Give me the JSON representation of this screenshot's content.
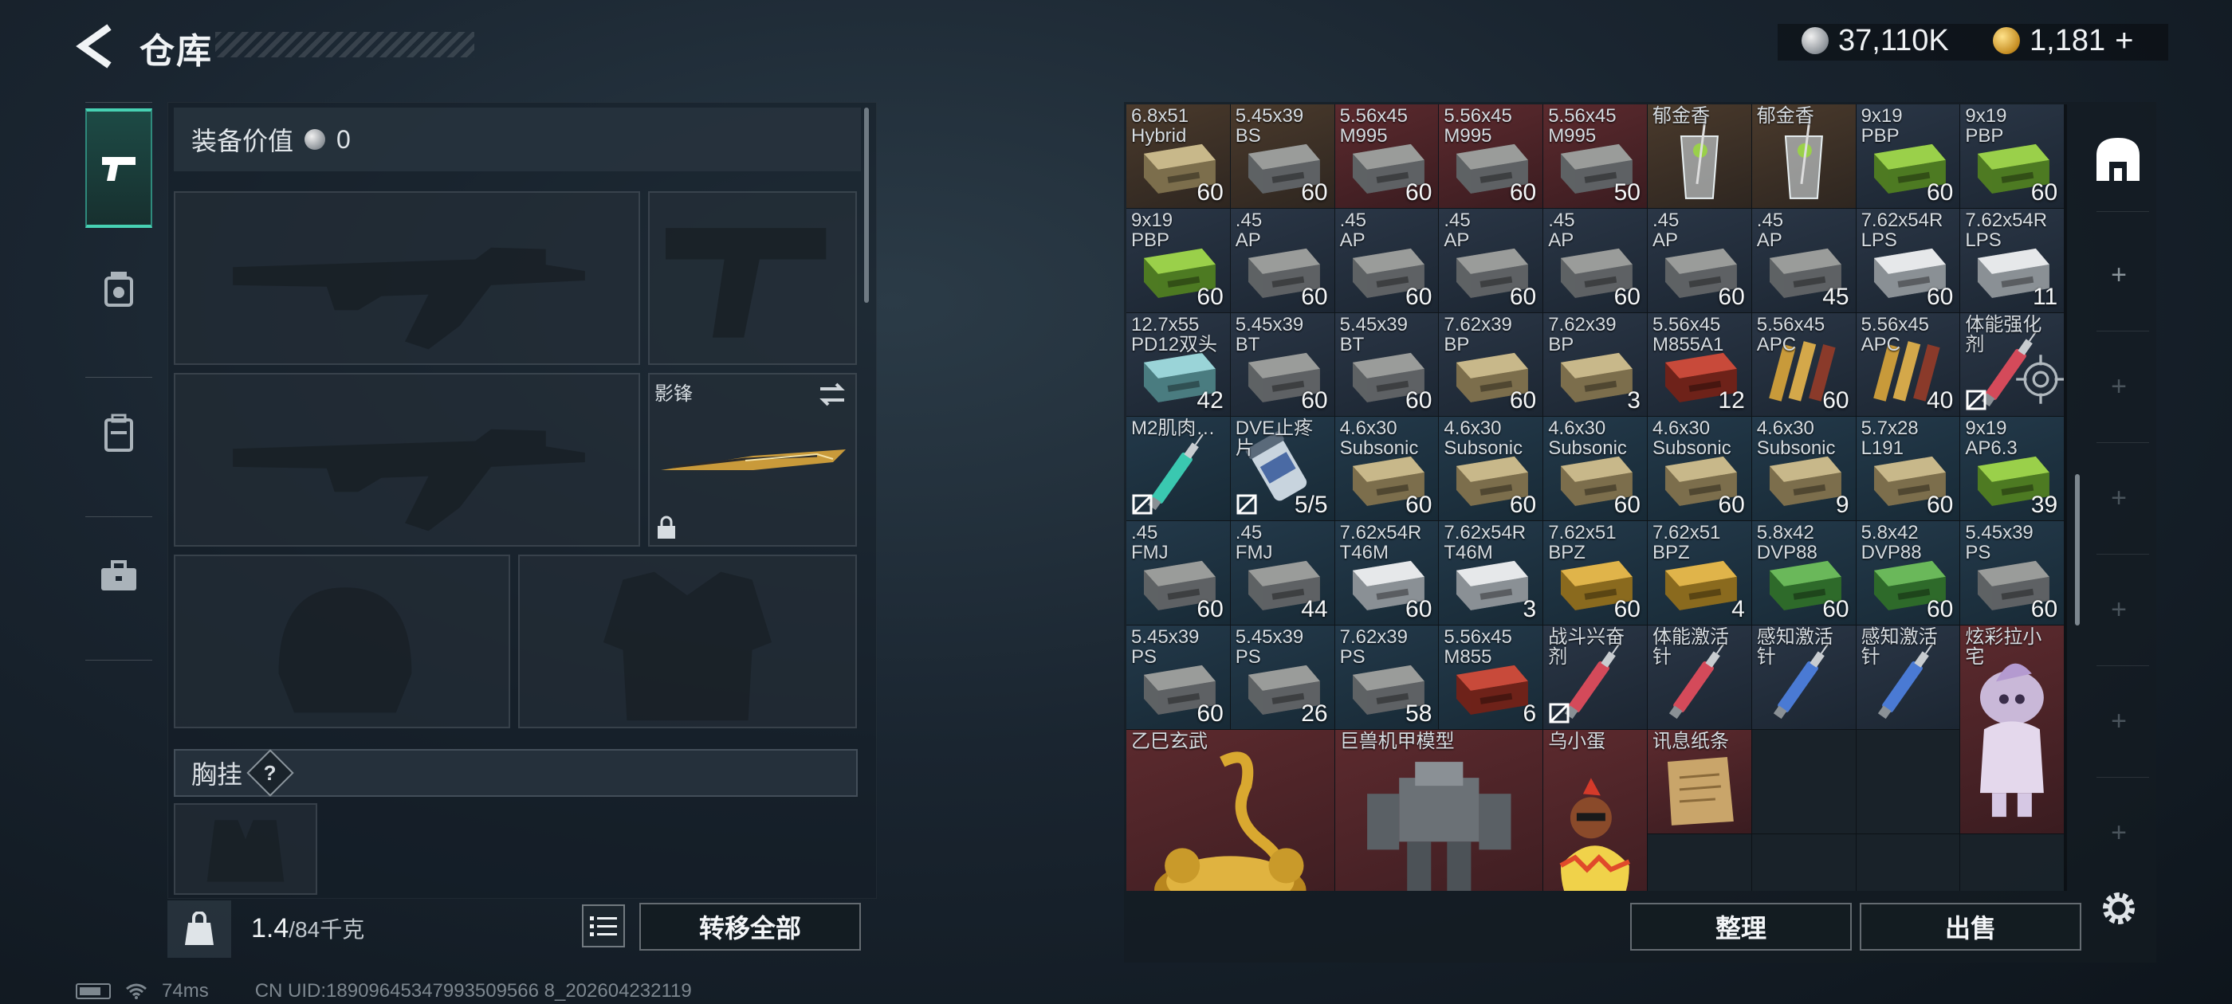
{
  "header": {
    "title": "仓库",
    "silver": "37,110K",
    "gold": "1,181",
    "gold_plus": "+"
  },
  "tabs": [
    {
      "name": "firearms",
      "icon": "pistol-icon",
      "active": true
    },
    {
      "name": "ammo",
      "icon": "ammo-pouch-icon",
      "active": false
    },
    {
      "name": "backpack",
      "icon": "backpack-icon",
      "active": false
    },
    {
      "name": "case",
      "icon": "case-icon",
      "active": false
    }
  ],
  "equipment": {
    "value_label": "装备价值",
    "value": "0",
    "knife_name": "影锋",
    "chest_rig_label": "胸挂",
    "help": "?"
  },
  "footer": {
    "weight_current": "1.4",
    "weight_capacity": "/84千克",
    "transfer_all": "转移全部",
    "sort": "整理",
    "sell": "出售"
  },
  "status": {
    "ping": "74ms",
    "uid": "CN UID:18909645347993509566 8_202604232119"
  },
  "inventory": {
    "items": [
      {
        "name": "6.8x51\nHybrid",
        "count": "60",
        "bg": "brown",
        "art": "ammo-tan"
      },
      {
        "name": "5.45x39\nBS",
        "count": "60",
        "bg": "brown",
        "art": "ammo-grey"
      },
      {
        "name": "5.56x45\nM995",
        "count": "60",
        "bg": "red",
        "art": "ammo-grey"
      },
      {
        "name": "5.56x45\nM995",
        "count": "60",
        "bg": "red",
        "art": "ammo-grey"
      },
      {
        "name": "5.56x45\nM995",
        "count": "50",
        "bg": "red",
        "art": "ammo-grey"
      },
      {
        "name": "郁金香",
        "count": "",
        "bg": "brown",
        "art": "glass"
      },
      {
        "name": "郁金香",
        "count": "",
        "bg": "brown",
        "art": "glass"
      },
      {
        "name": "9x19\nPBP",
        "count": "60",
        "bg": "navy",
        "art": "ammo-green"
      },
      {
        "name": "9x19\nPBP",
        "count": "60",
        "bg": "navy",
        "art": "ammo-green"
      },
      {
        "name": "9x19\nPBP",
        "count": "60",
        "bg": "navy",
        "art": "ammo-green"
      },
      {
        "name": ".45\nAP",
        "count": "60",
        "bg": "navy",
        "art": "ammo-grey"
      },
      {
        "name": ".45\nAP",
        "count": "60",
        "bg": "navy",
        "art": "ammo-grey"
      },
      {
        "name": ".45\nAP",
        "count": "60",
        "bg": "navy",
        "art": "ammo-grey"
      },
      {
        "name": ".45\nAP",
        "count": "60",
        "bg": "navy",
        "art": "ammo-grey"
      },
      {
        "name": ".45\nAP",
        "count": "60",
        "bg": "navy",
        "art": "ammo-grey"
      },
      {
        "name": ".45\nAP",
        "count": "45",
        "bg": "navy",
        "art": "ammo-grey"
      },
      {
        "name": "7.62x54R\nLPS",
        "count": "60",
        "bg": "navy",
        "art": "ammo-white"
      },
      {
        "name": "7.62x54R\nLPS",
        "count": "11",
        "bg": "navy",
        "art": "ammo-white"
      },
      {
        "name": "12.7x55\nPD12双头",
        "count": "42",
        "bg": "navy",
        "art": "ammo-cyan"
      },
      {
        "name": "5.45x39\nBT",
        "count": "60",
        "bg": "navy",
        "art": "ammo-grey"
      },
      {
        "name": "5.45x39\nBT",
        "count": "60",
        "bg": "navy",
        "art": "ammo-grey"
      },
      {
        "name": "7.62x39\nBP",
        "count": "60",
        "bg": "navy",
        "art": "ammo-tan"
      },
      {
        "name": "7.62x39\nBP",
        "count": "3",
        "bg": "navy",
        "art": "ammo-tan"
      },
      {
        "name": "5.56x45\nM855A1",
        "count": "12",
        "bg": "navy",
        "art": "ammo-red"
      },
      {
        "name": "5.56x45\nAPC",
        "count": "60",
        "bg": "navy",
        "art": "rounds"
      },
      {
        "name": "5.56x45\nAPC",
        "count": "40",
        "bg": "navy",
        "art": "rounds"
      },
      {
        "name": "体能强化剂",
        "count": "",
        "bg": "navy",
        "art": "injector-red",
        "nodrop": true,
        "locked_target": true
      },
      {
        "name": "M2肌肉…",
        "count": "",
        "bg": "teal",
        "art": "injector-teal",
        "nodrop": true
      },
      {
        "name": "DVE止疼片",
        "count": "5/5",
        "bg": "teal",
        "art": "pills",
        "nodrop": true
      },
      {
        "name": "4.6x30\nSubsonic",
        "count": "60",
        "bg": "teal",
        "art": "ammo-tan"
      },
      {
        "name": "4.6x30\nSubsonic",
        "count": "60",
        "bg": "teal",
        "art": "ammo-tan"
      },
      {
        "name": "4.6x30\nSubsonic",
        "count": "60",
        "bg": "teal",
        "art": "ammo-tan"
      },
      {
        "name": "4.6x30\nSubsonic",
        "count": "60",
        "bg": "teal",
        "art": "ammo-tan"
      },
      {
        "name": "4.6x30\nSubsonic",
        "count": "9",
        "bg": "teal",
        "art": "ammo-tan"
      },
      {
        "name": "5.7x28\nL191",
        "count": "60",
        "bg": "teal",
        "art": "ammo-tan"
      },
      {
        "name": "9x19\nAP6.3",
        "count": "39",
        "bg": "teal",
        "art": "ammo-green"
      },
      {
        "name": ".45\nFMJ",
        "count": "60",
        "bg": "teal",
        "art": "ammo-grey"
      },
      {
        "name": ".45\nFMJ",
        "count": "44",
        "bg": "teal",
        "art": "ammo-grey"
      },
      {
        "name": "7.62x54R\nT46M",
        "count": "60",
        "bg": "teal",
        "art": "ammo-white"
      },
      {
        "name": "7.62x54R\nT46M",
        "count": "3",
        "bg": "teal",
        "art": "ammo-white"
      },
      {
        "name": "7.62x51\nBPZ",
        "count": "60",
        "bg": "teal",
        "art": "ammo-gold"
      },
      {
        "name": "7.62x51\nBPZ",
        "count": "4",
        "bg": "teal",
        "art": "ammo-gold"
      },
      {
        "name": "5.8x42\nDVP88",
        "count": "60",
        "bg": "teal",
        "art": "ammo-lime"
      },
      {
        "name": "5.8x42\nDVP88",
        "count": "60",
        "bg": "teal",
        "art": "ammo-lime"
      },
      {
        "name": "5.45x39\nPS",
        "count": "60",
        "bg": "teal",
        "art": "ammo-grey"
      },
      {
        "name": "5.45x39\nPS",
        "count": "60",
        "bg": "teal",
        "art": "ammo-grey"
      },
      {
        "name": "5.45x39\nPS",
        "count": "26",
        "bg": "teal",
        "art": "ammo-grey"
      },
      {
        "name": "7.62x39\nPS",
        "count": "58",
        "bg": "teal",
        "art": "ammo-grey"
      },
      {
        "name": "5.56x45\nM855",
        "count": "6",
        "bg": "teal",
        "art": "ammo-red"
      },
      {
        "name": "战斗兴奋剂",
        "count": "",
        "bg": "navy",
        "art": "injector-red",
        "nodrop": true
      },
      {
        "name": "体能激活针",
        "count": "",
        "bg": "navy",
        "art": "injector-red"
      },
      {
        "name": "感知激活针",
        "count": "",
        "bg": "navy",
        "art": "injector-blue"
      },
      {
        "name": "感知激活针",
        "count": "",
        "bg": "navy",
        "art": "injector-blue"
      }
    ],
    "large_items": [
      {
        "name": "炫彩拉小宅",
        "art": "figurine"
      },
      {
        "name": "乙巳玄武",
        "art": "dragon"
      },
      {
        "name": "巨兽机甲模型",
        "art": "mech"
      },
      {
        "name": "乌小蛋",
        "art": "chick"
      },
      {
        "name": "讯息纸条",
        "art": "note"
      }
    ]
  },
  "colors": {
    "accent": "#47d1b3",
    "brown": "#4a3a2c",
    "navy": "#2a3646",
    "red": "#5c2a2e",
    "teal": "#23394a"
  }
}
